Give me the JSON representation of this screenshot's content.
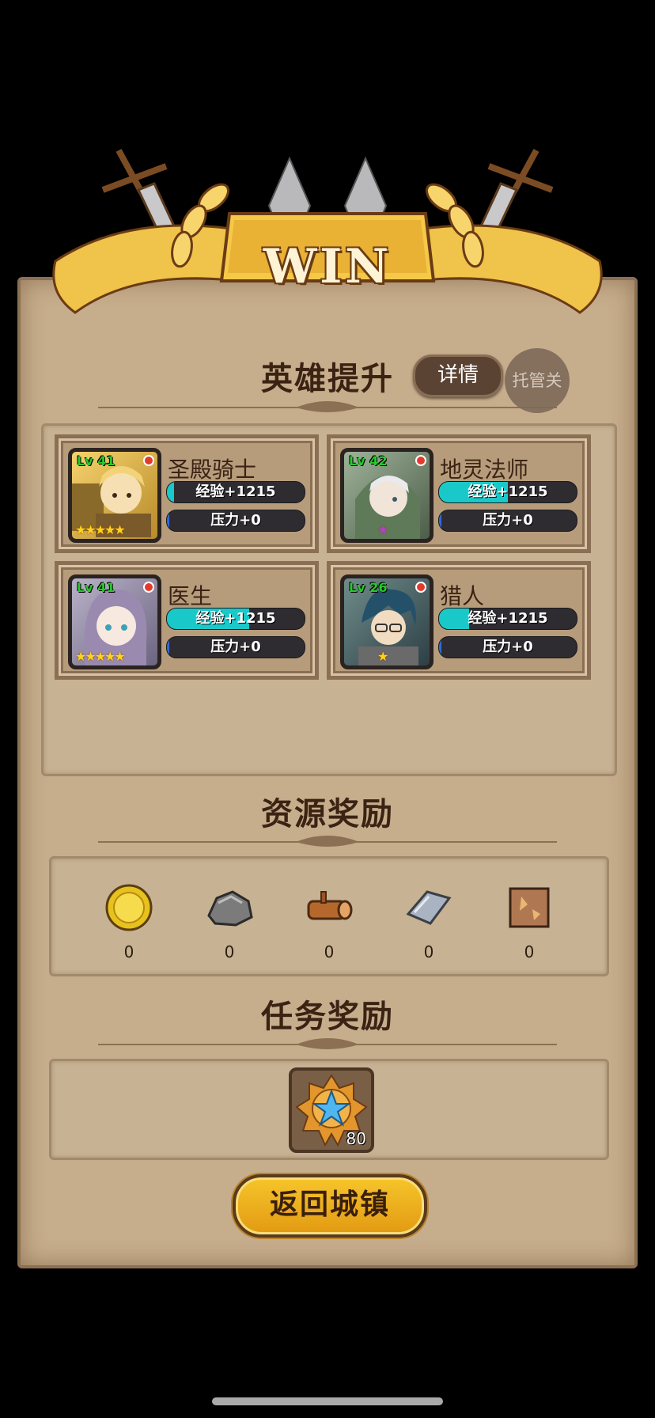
{
  "banner": {
    "title": "WIN"
  },
  "hero_section": {
    "title": "英雄提升",
    "detail_label": "详情",
    "auto_label": "托管关"
  },
  "heroes": [
    {
      "name": "圣殿骑士",
      "level": "Lv 41",
      "stars": "★★★★★",
      "exp_text": "经验+1215",
      "exp_fill": 0.05,
      "stress_text": "压力+0",
      "stress_fill": 0.02
    },
    {
      "name": "地灵法师",
      "level": "Lv 42",
      "stars": "★",
      "exp_text": "经验+1215",
      "exp_fill": 0.5,
      "stress_text": "压力+0",
      "stress_fill": 0.02
    },
    {
      "name": "医生",
      "level": "Lv 41",
      "stars": "★★★★★",
      "exp_text": "经验+1215",
      "exp_fill": 0.6,
      "stress_text": "压力+0",
      "stress_fill": 0.02
    },
    {
      "name": "猎人",
      "level": "Lv 26",
      "stars": "★",
      "exp_text": "经验+1215",
      "exp_fill": 0.22,
      "stress_text": "压力+0",
      "stress_fill": 0.02
    }
  ],
  "resource_section": {
    "title": "资源奖励",
    "items": [
      {
        "icon": "gold-coin-icon",
        "value": "0"
      },
      {
        "icon": "stone-icon",
        "value": "0"
      },
      {
        "icon": "wood-log-icon",
        "value": "0"
      },
      {
        "icon": "iron-ingot-icon",
        "value": "0"
      },
      {
        "icon": "leather-icon",
        "value": "0"
      }
    ]
  },
  "task_section": {
    "title": "任务奖励",
    "items": [
      {
        "icon": "star-medal-icon",
        "quantity": "80"
      }
    ]
  },
  "return_button": {
    "label": "返回城镇"
  },
  "colors": {
    "panel": "#c6ad8c",
    "gold": "#f0b92c",
    "exp_bar": "#19c9c9",
    "stress_bar": "#2f6bd8",
    "level_text": "#28c92d"
  }
}
